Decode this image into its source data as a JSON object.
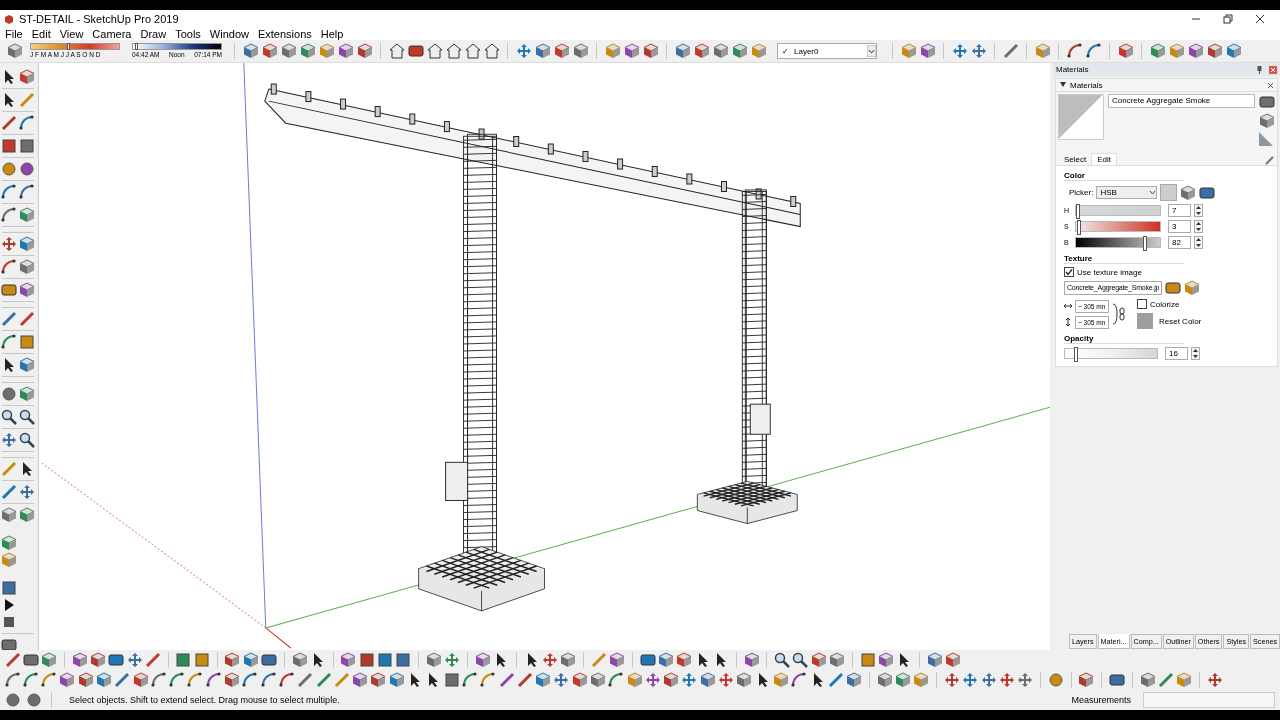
{
  "window": {
    "title": "ST-DETAIL - SketchUp Pro 2019"
  },
  "menu": [
    "File",
    "Edit",
    "View",
    "Camera",
    "Draw",
    "Tools",
    "Window",
    "Extensions",
    "Help"
  ],
  "shadow_settings": {
    "month_slider": {
      "months": "J F M A M J J A S O N D",
      "level": 0.42
    },
    "time_slider": {
      "sunrise": "04:42 AM",
      "noon": "Noon",
      "sunset": "07:14 PM",
      "level": 0.03
    }
  },
  "layer_selector": {
    "check": "✓",
    "value": "Layer0"
  },
  "tray": {
    "title": "Materials",
    "panel": {
      "title": "Materials",
      "material_name": "Concrete Aggregate Smoke",
      "tabs": [
        {
          "label": "Select",
          "selected": false
        },
        {
          "label": "Edit",
          "selected": true
        }
      ],
      "color": {
        "heading": "Color",
        "picker_label": "Picker:",
        "picker_value": "HSB",
        "channels": [
          {
            "kind": "hue",
            "label": "H",
            "level": 0.02,
            "value": "7"
          },
          {
            "kind": "saturation",
            "label": "S",
            "level": 0.03,
            "value": "3"
          },
          {
            "kind": "brightness",
            "label": "B",
            "level": 0.82,
            "value": "82"
          }
        ]
      },
      "texture": {
        "heading": "Texture",
        "use_texture": {
          "label": "Use texture image",
          "checked": true
        },
        "file": "Concrete_Aggregate_Smoke.jp",
        "width": "~ 305 mn",
        "height": "~ 305 mn",
        "colorize": {
          "label": "Colorize",
          "checked": false
        },
        "reset": "Reset Color"
      },
      "opacity": {
        "heading": "Opacity",
        "level": 0.12,
        "value": "16"
      }
    }
  },
  "tray_tabs": [
    {
      "label": "Layers",
      "selected": false
    },
    {
      "label": "Materi...",
      "selected": true
    },
    {
      "label": "Comp...",
      "selected": false
    },
    {
      "label": "Outliner",
      "selected": false
    },
    {
      "label": "Others",
      "selected": false
    },
    {
      "label": "Styles",
      "selected": false
    },
    {
      "label": "Scenes",
      "selected": false
    }
  ],
  "status_bar": {
    "message": "Select objects. Shift to extend select. Drag mouse to select multiple.",
    "measurements_label": "Measurements"
  }
}
